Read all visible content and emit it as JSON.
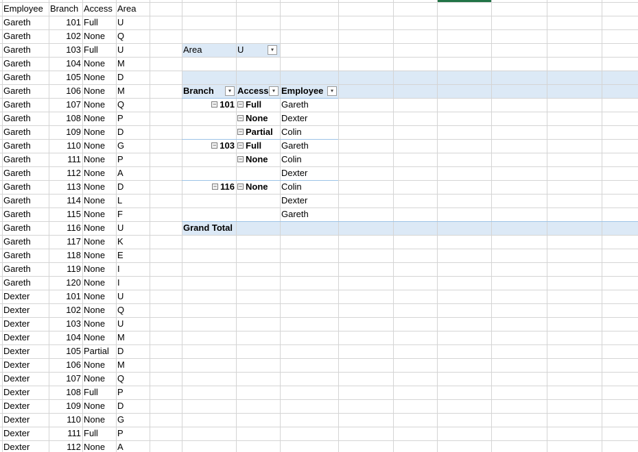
{
  "source_table": {
    "headers": [
      "Employee",
      "Branch",
      "Access",
      "Area"
    ],
    "rows": [
      [
        "Gareth",
        "101",
        "Full",
        "U"
      ],
      [
        "Gareth",
        "102",
        "None",
        "Q"
      ],
      [
        "Gareth",
        "103",
        "Full",
        "U"
      ],
      [
        "Gareth",
        "104",
        "None",
        "M"
      ],
      [
        "Gareth",
        "105",
        "None",
        "D"
      ],
      [
        "Gareth",
        "106",
        "None",
        "M"
      ],
      [
        "Gareth",
        "107",
        "None",
        "Q"
      ],
      [
        "Gareth",
        "108",
        "None",
        "P"
      ],
      [
        "Gareth",
        "109",
        "None",
        "D"
      ],
      [
        "Gareth",
        "110",
        "None",
        "G"
      ],
      [
        "Gareth",
        "111",
        "None",
        "P"
      ],
      [
        "Gareth",
        "112",
        "None",
        "A"
      ],
      [
        "Gareth",
        "113",
        "None",
        "D"
      ],
      [
        "Gareth",
        "114",
        "None",
        "L"
      ],
      [
        "Gareth",
        "115",
        "None",
        "F"
      ],
      [
        "Gareth",
        "116",
        "None",
        "U"
      ],
      [
        "Gareth",
        "117",
        "None",
        "K"
      ],
      [
        "Gareth",
        "118",
        "None",
        "E"
      ],
      [
        "Gareth",
        "119",
        "None",
        "I"
      ],
      [
        "Gareth",
        "120",
        "None",
        "I"
      ],
      [
        "Dexter",
        "101",
        "None",
        "U"
      ],
      [
        "Dexter",
        "102",
        "None",
        "Q"
      ],
      [
        "Dexter",
        "103",
        "None",
        "U"
      ],
      [
        "Dexter",
        "104",
        "None",
        "M"
      ],
      [
        "Dexter",
        "105",
        "Partial",
        "D"
      ],
      [
        "Dexter",
        "106",
        "None",
        "M"
      ],
      [
        "Dexter",
        "107",
        "None",
        "Q"
      ],
      [
        "Dexter",
        "108",
        "Full",
        "P"
      ],
      [
        "Dexter",
        "109",
        "None",
        "D"
      ],
      [
        "Dexter",
        "110",
        "None",
        "G"
      ],
      [
        "Dexter",
        "111",
        "Full",
        "P"
      ],
      [
        "Dexter",
        "112",
        "None",
        "A"
      ]
    ]
  },
  "pivot": {
    "filter": {
      "label": "Area",
      "value": "U"
    },
    "headers": {
      "branch": "Branch",
      "access": "Access",
      "employee": "Employee"
    },
    "rows": [
      {
        "branch": "101",
        "access": "Full",
        "employee": "Gareth"
      },
      {
        "branch": "",
        "access": "None",
        "employee": "Dexter"
      },
      {
        "branch": "",
        "access": "Partial",
        "employee": "Colin"
      },
      {
        "branch": "103",
        "access": "Full",
        "employee": "Gareth"
      },
      {
        "branch": "",
        "access": "None",
        "employee": "Colin"
      },
      {
        "branch": "",
        "access": "",
        "employee": "Dexter"
      },
      {
        "branch": "116",
        "access": "None",
        "employee": "Colin"
      },
      {
        "branch": "",
        "access": "",
        "employee": "Dexter"
      },
      {
        "branch": "",
        "access": "",
        "employee": "Gareth"
      }
    ],
    "grand_total": "Grand Total"
  },
  "colors": {
    "pivot_band": "#dce9f6",
    "pivot_border": "#9bc2e6",
    "gridline": "#d4d4d4",
    "selection": "#217346"
  }
}
